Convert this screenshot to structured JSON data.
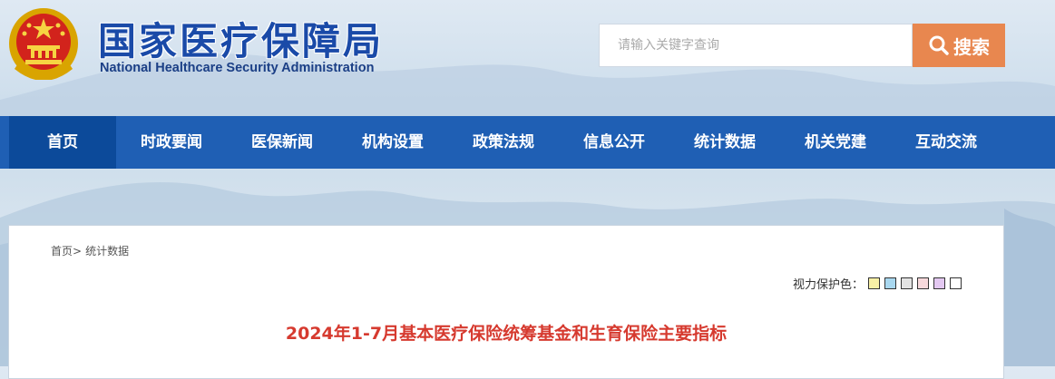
{
  "header": {
    "title_cn": "国家医疗保障局",
    "title_en": "National Healthcare Security Administration",
    "logo_icon": "national-emblem-icon"
  },
  "search": {
    "placeholder": "请输入关键字查询",
    "button_label": "搜索",
    "button_color": "#e8874f"
  },
  "nav": {
    "color": "#1f5fb4",
    "active_color": "#0c4a9a",
    "items": [
      {
        "label": "首页"
      },
      {
        "label": "时政要闻"
      },
      {
        "label": "医保新闻"
      },
      {
        "label": "机构设置"
      },
      {
        "label": "政策法规"
      },
      {
        "label": "信息公开"
      },
      {
        "label": "统计数据"
      },
      {
        "label": "机关党建"
      },
      {
        "label": "互动交流"
      }
    ]
  },
  "breadcrumb": {
    "home": "首页>",
    "current": "统计数据"
  },
  "vision": {
    "label": "视力保护色：",
    "colors": [
      "#f9f1a6",
      "#a9d8f0",
      "#e3e3e3",
      "#f7d9dc",
      "#e3c8f1",
      "#ffffff"
    ]
  },
  "article": {
    "title": "2024年1-7月基本医疗保险统筹基金和生育保险主要指标",
    "title_color": "#d63a2f"
  }
}
